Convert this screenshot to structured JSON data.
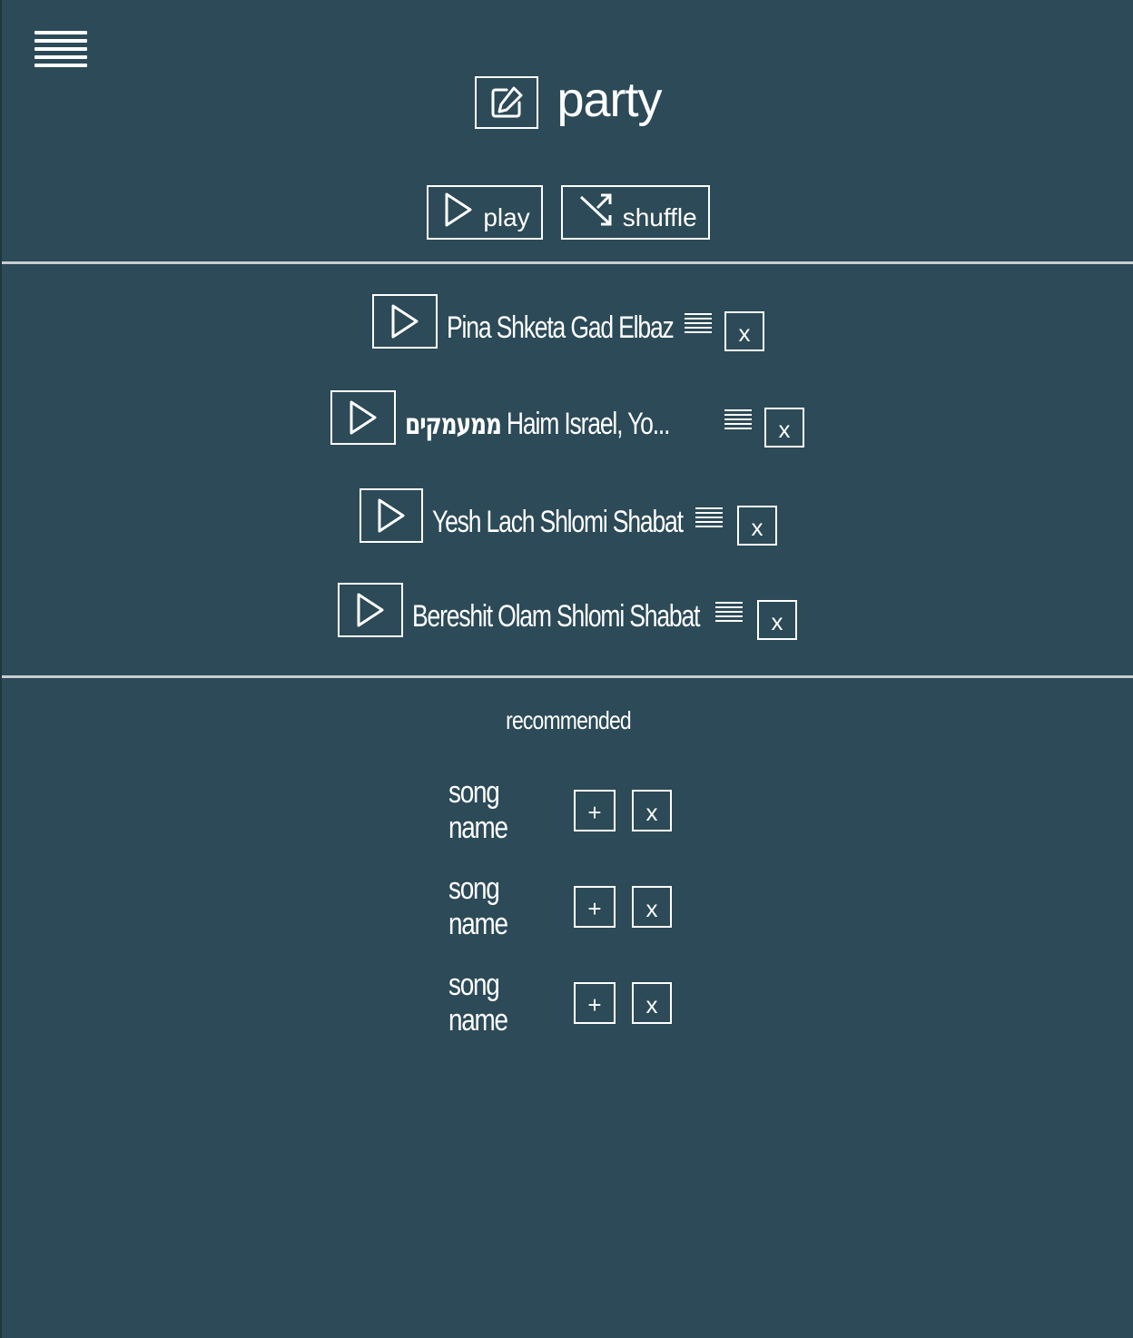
{
  "header": {
    "menu_icon": "hamburger-menu-icon",
    "edit_icon": "edit-pencil-icon",
    "playlist_name": "party"
  },
  "controls": {
    "play_label": "play",
    "play_icon": "play-triangle-icon",
    "shuffle_label": "shuffle",
    "shuffle_icon": "shuffle-icon"
  },
  "songs": [
    {
      "hebrew": "",
      "title": "Pina Shketa Gad Elbaz",
      "remove_label": "x"
    },
    {
      "hebrew": "ממעמקים",
      "title": " Haim Israel, Yo...",
      "remove_label": "x"
    },
    {
      "hebrew": "",
      "title": "Yesh Lach Shlomi Shabat",
      "remove_label": "x"
    },
    {
      "hebrew": "",
      "title": "Bereshit Olam Shlomi Shabat",
      "remove_label": "x"
    }
  ],
  "recommended": {
    "heading": "recommended",
    "items": [
      {
        "name": "song name",
        "add_label": "+",
        "remove_label": "x"
      },
      {
        "name": "song name",
        "add_label": "+",
        "remove_label": "x"
      },
      {
        "name": "song name",
        "add_label": "+",
        "remove_label": "x"
      }
    ]
  },
  "colors": {
    "background": "#2c4a57",
    "foreground": "#ffffff",
    "divider": "#c8cdd0"
  }
}
